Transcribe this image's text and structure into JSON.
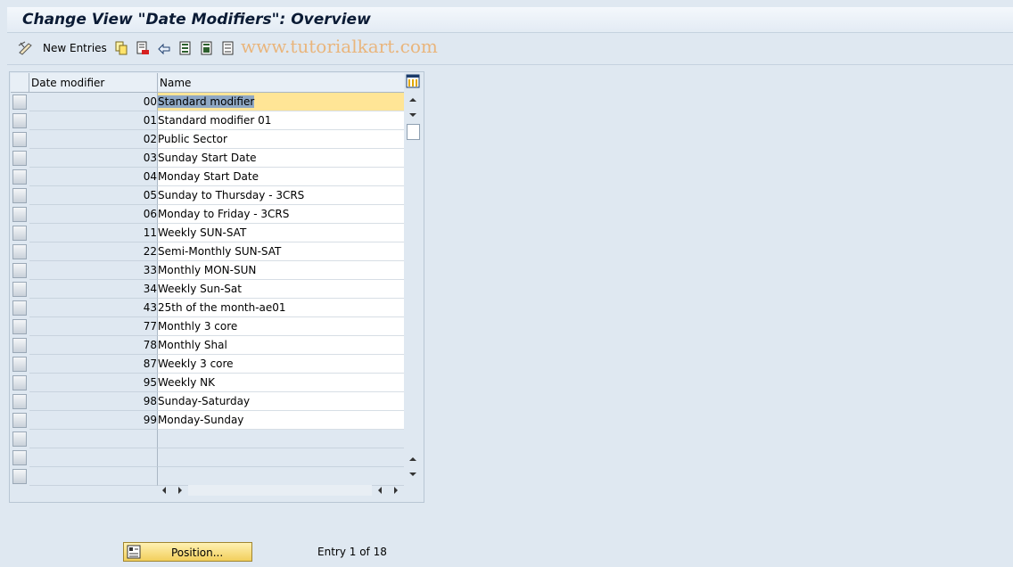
{
  "window": {
    "title": "Change View \"Date Modifiers\": Overview"
  },
  "toolbar": {
    "new_entries_label": "New Entries",
    "icons": [
      "edit-glasses-icon",
      "copy-icon",
      "delete-icon",
      "undo-icon",
      "select-all-icon",
      "select-block-icon",
      "deselect-all-icon"
    ],
    "watermark": "www.tutorialkart.com"
  },
  "table": {
    "columns": [
      "Date modifier",
      "Name"
    ],
    "rows": [
      {
        "code": "00",
        "name": "Standard modifier"
      },
      {
        "code": "01",
        "name": "Standard modifier 01"
      },
      {
        "code": "02",
        "name": "Public Sector"
      },
      {
        "code": "03",
        "name": "Sunday Start Date"
      },
      {
        "code": "04",
        "name": "Monday Start Date"
      },
      {
        "code": "05",
        "name": "Sunday to Thursday - 3CRS"
      },
      {
        "code": "06",
        "name": "Monday to Friday - 3CRS"
      },
      {
        "code": "11",
        "name": "Weekly SUN-SAT"
      },
      {
        "code": "22",
        "name": "Semi-Monthly SUN-SAT"
      },
      {
        "code": "33",
        "name": "Monthly MON-SUN"
      },
      {
        "code": "34",
        "name": "Weekly Sun-Sat"
      },
      {
        "code": "43",
        "name": "25th of the month-ae01"
      },
      {
        "code": "77",
        "name": "Monthly 3 core"
      },
      {
        "code": "78",
        "name": "Monthly Shal"
      },
      {
        "code": "87",
        "name": "Weekly 3 core"
      },
      {
        "code": "95",
        "name": "Weekly NK"
      },
      {
        "code": "98",
        "name": "Sunday-Saturday"
      },
      {
        "code": "99",
        "name": "Monday-Sunday"
      }
    ]
  },
  "footer": {
    "position_label": "Position...",
    "entry_info": "Entry 1 of 18"
  }
}
